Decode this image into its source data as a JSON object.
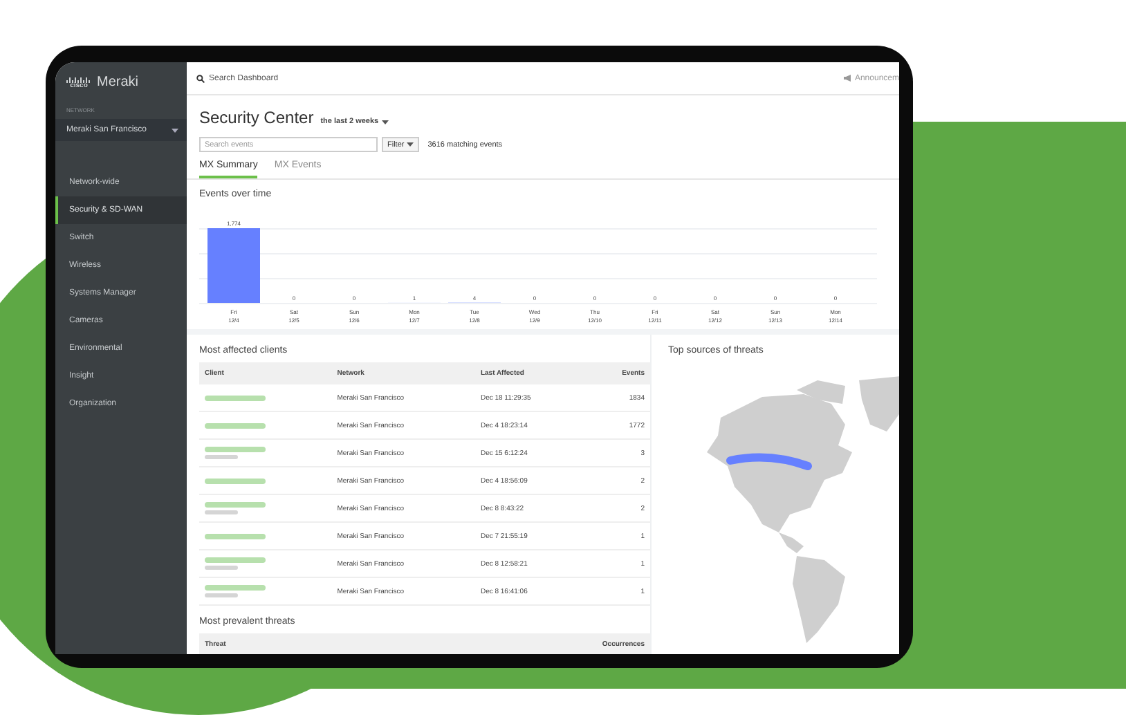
{
  "sidebar": {
    "brand": {
      "vendor": "cisco",
      "product": "Meraki"
    },
    "network_label": "NETWORK",
    "network": "Meraki San Francisco",
    "items": [
      {
        "label": "Network-wide",
        "selected": false
      },
      {
        "label": "Security & SD-WAN",
        "selected": true
      },
      {
        "label": "Switch",
        "selected": false
      },
      {
        "label": "Wireless",
        "selected": false
      },
      {
        "label": "Systems Manager",
        "selected": false
      },
      {
        "label": "Cameras",
        "selected": false
      },
      {
        "label": "Environmental",
        "selected": false
      },
      {
        "label": "Insight",
        "selected": false
      },
      {
        "label": "Organization",
        "selected": false
      }
    ]
  },
  "topbar": {
    "search_placeholder": "Search Dashboard",
    "announcements": "Announcem"
  },
  "header": {
    "title": "Security Center",
    "range": "the last 2 weeks"
  },
  "filters": {
    "search_placeholder": "Search events",
    "filter_button": "Filter",
    "match_count": "3616 matching events"
  },
  "tabs": [
    {
      "label": "MX Summary",
      "selected": true
    },
    {
      "label": "MX Events",
      "selected": false
    }
  ],
  "events_over_time": {
    "title": "Events over time",
    "chart_data": {
      "type": "bar",
      "data_labels": true,
      "categories": [
        "Fri 12/4",
        "Sat 12/5",
        "Sun 12/6",
        "Mon 12/7",
        "Tue 12/8",
        "Wed 12/9",
        "Thu 12/10",
        "Fri 12/11",
        "Sat 12/12",
        "Sun 12/13",
        "Mon 12/14"
      ],
      "series": [
        {
          "color": "#6680ff",
          "value_labels": [
            "1,774",
            "0",
            "0",
            "1",
            "4",
            "0",
            "0",
            "0",
            "0",
            "0",
            "0"
          ],
          "values": [
            1774,
            0,
            0,
            1,
            4,
            0,
            0,
            0,
            0,
            0,
            0
          ]
        }
      ]
    }
  },
  "clients": {
    "title": "Most affected clients",
    "columns": [
      "Client",
      "Network",
      "Last Affected",
      "Events"
    ],
    "rows": [
      {
        "client_subtitle": false,
        "network": "Meraki San Francisco",
        "last_affected": "Dec 18 11:29:35",
        "events": "1834"
      },
      {
        "client_subtitle": false,
        "network": "Meraki San Francisco",
        "last_affected": "Dec 4 18:23:14",
        "events": "1772"
      },
      {
        "client_subtitle": true,
        "network": "Meraki San Francisco",
        "last_affected": "Dec 15 6:12:24",
        "events": "3"
      },
      {
        "client_subtitle": false,
        "network": "Meraki San Francisco",
        "last_affected": "Dec 4 18:56:09",
        "events": "2"
      },
      {
        "client_subtitle": true,
        "network": "Meraki San Francisco",
        "last_affected": "Dec 8 8:43:22",
        "events": "2"
      },
      {
        "client_subtitle": false,
        "network": "Meraki San Francisco",
        "last_affected": "Dec 7 21:55:19",
        "events": "1"
      },
      {
        "client_subtitle": true,
        "network": "Meraki San Francisco",
        "last_affected": "Dec 8 12:58:21",
        "events": "1"
      },
      {
        "client_subtitle": true,
        "network": "Meraki San Francisco",
        "last_affected": "Dec 8 16:41:06",
        "events": "1"
      }
    ]
  },
  "threats": {
    "title": "Most prevalent threats",
    "columns": [
      "Threat",
      "Occurrences"
    ]
  },
  "map": {
    "title": "Top sources of threats"
  }
}
